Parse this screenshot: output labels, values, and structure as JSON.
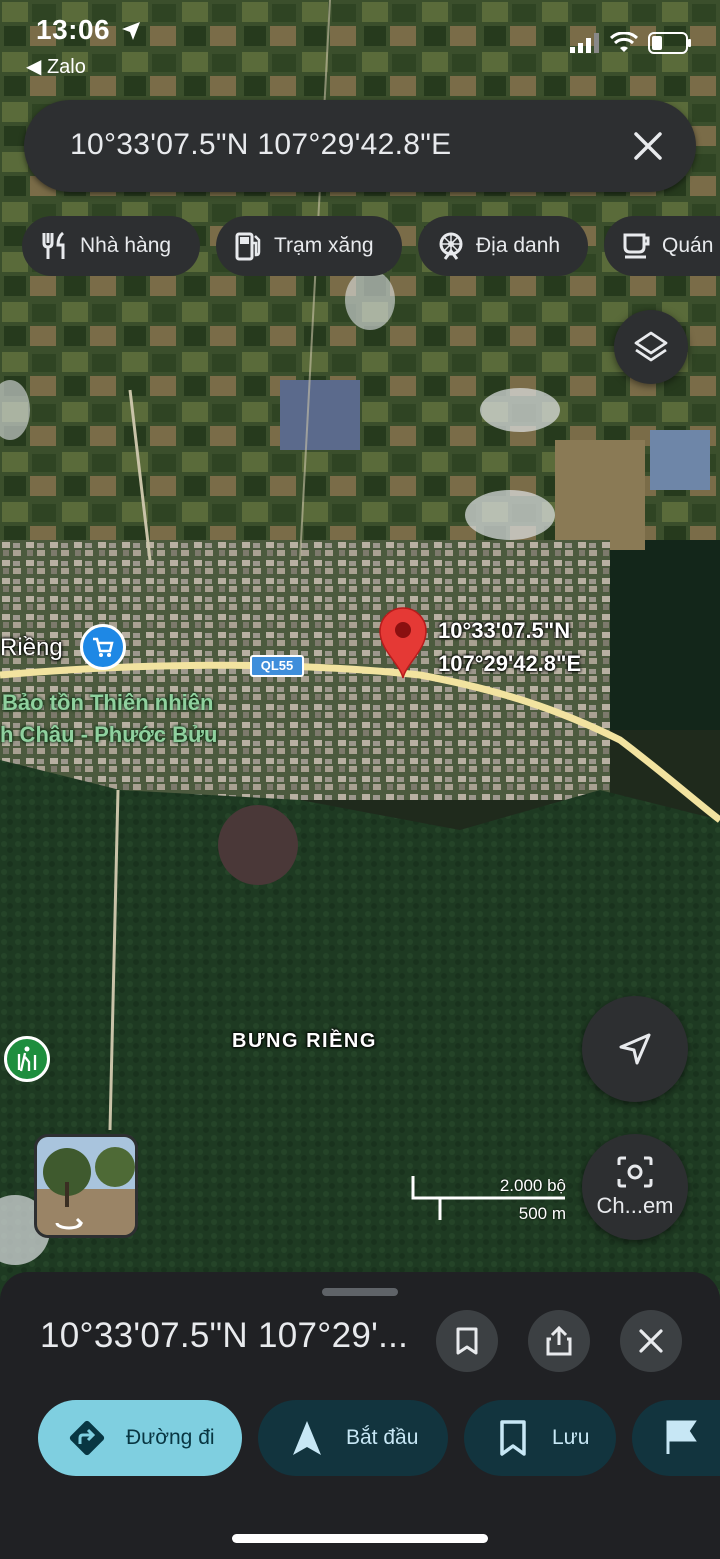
{
  "status_bar": {
    "time": "13:06",
    "back_app": "◀ Zalo"
  },
  "search": {
    "query": "10°33'07.5\"N 107°29'42.8\"E"
  },
  "chips": [
    {
      "label": "Nhà hàng",
      "icon": "restaurant-icon"
    },
    {
      "label": "Trạm xăng",
      "icon": "gas-station-icon"
    },
    {
      "label": "Địa danh",
      "icon": "landmark-icon"
    },
    {
      "label": "Quán",
      "icon": "coffee-icon"
    }
  ],
  "map": {
    "pin_label_line1": "10°33'07.5\"N",
    "pin_label_line2": "107°29'42.8\"E",
    "road_shield": "QL55",
    "place_partial": "Riềng",
    "reserve_line1": "Bảo tồn Thiên nhiên",
    "reserve_line2": "h Châu - Phước Bửu",
    "area_label": "BƯNG RIỀNG",
    "scale_imperial": "2.000 bộ",
    "scale_metric": "500 m",
    "lens_label": "Ch...em"
  },
  "sheet": {
    "title": "10°33'07.5\"N 107°29'...",
    "actions": [
      {
        "label": "Đường đi",
        "icon": "directions-icon",
        "primary": true
      },
      {
        "label": "Bắt đầu",
        "icon": "navigation-arrow-icon",
        "primary": false
      },
      {
        "label": "Lưu",
        "icon": "bookmark-icon",
        "primary": false
      },
      {
        "label": "",
        "icon": "flag-icon",
        "primary": false
      }
    ]
  },
  "colors": {
    "panel": "#2d2f31",
    "sheet": "#202124",
    "primary_action": "#7fcfe0",
    "secondary_action": "#12343e",
    "pin": "#e53935",
    "road": "#f2e3a0"
  }
}
